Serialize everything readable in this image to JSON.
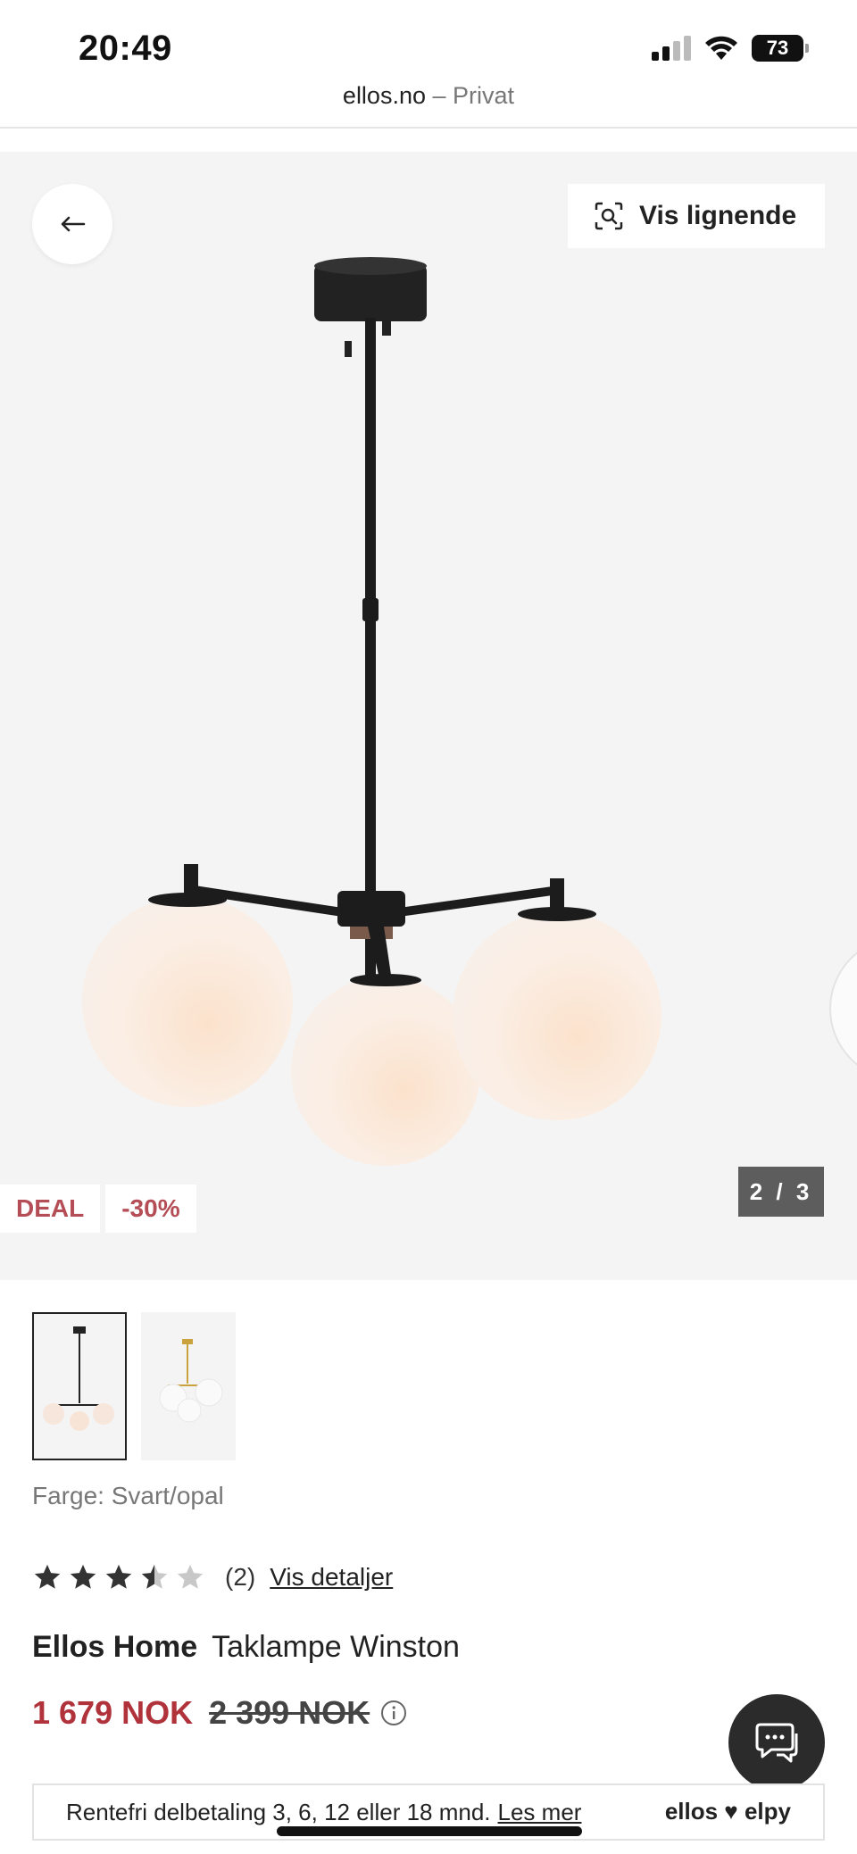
{
  "status_bar": {
    "time": "20:49",
    "battery": "73"
  },
  "browser": {
    "domain": "ellos.no",
    "separator": " – ",
    "mode": "Privat"
  },
  "hero": {
    "similar_button_label": "Vis lignende",
    "deal_badge": "DEAL",
    "discount_badge": "-30%",
    "pager": "2 / 3"
  },
  "product": {
    "color_label": "Farge: Svart/opal",
    "rating": {
      "value": 3.5,
      "max": 5,
      "count_text": "(2)",
      "details_link": "Vis detaljer"
    },
    "brand": "Ellos Home",
    "name": "Taklampe Winston",
    "price_now": "1 679 NOK",
    "price_old": "2 399 NOK"
  },
  "installment": {
    "text": "Rentefri delbetaling 3, 6, 12 eller 18 mnd.",
    "link": "Les mer",
    "partner": "ellos ♥ elpy"
  },
  "colors": {
    "accent_red": "#b0323b",
    "badge_red": "#b54d57",
    "hero_bg": "#f4f4f4"
  }
}
